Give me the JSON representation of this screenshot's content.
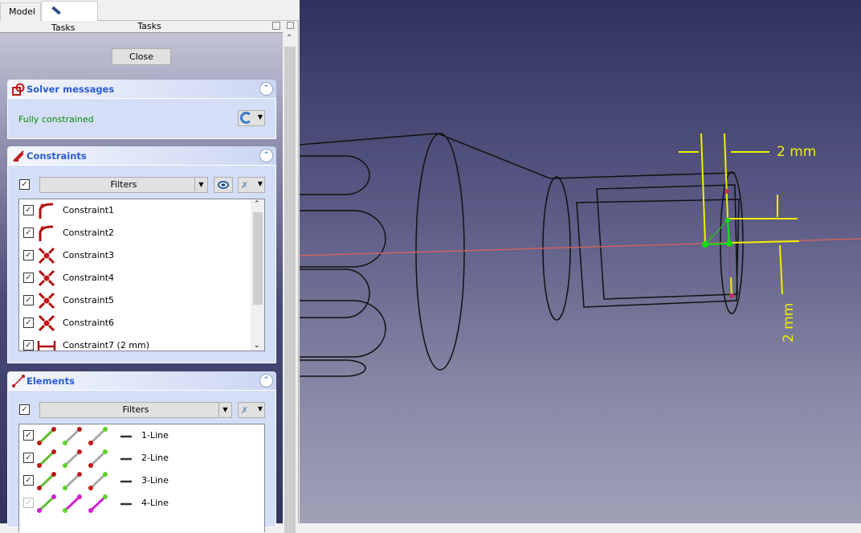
{
  "tabs": [
    {
      "label": "Model",
      "active": false
    },
    {
      "label": "Tasks",
      "active": true
    }
  ],
  "tasks_header": "Tasks",
  "close_button": "Close",
  "solver": {
    "title": "Solver messages",
    "status": "Fully constrained",
    "status_color": "#0a8a0a"
  },
  "constraints": {
    "title": "Constraints",
    "filter_label": "Filters",
    "items": [
      {
        "label": "Constraint1",
        "icon": "tangent-icon",
        "checked": true
      },
      {
        "label": "Constraint2",
        "icon": "tangent-icon",
        "checked": true
      },
      {
        "label": "Constraint3",
        "icon": "coincident-icon",
        "checked": true
      },
      {
        "label": "Constraint4",
        "icon": "coincident-icon",
        "checked": true
      },
      {
        "label": "Constraint5",
        "icon": "coincident-icon",
        "checked": true
      },
      {
        "label": "Constraint6",
        "icon": "coincident-icon",
        "checked": true
      },
      {
        "label": "Constraint7 (2 mm)",
        "icon": "horizontal-distance-icon",
        "checked": true
      }
    ]
  },
  "elements": {
    "title": "Elements",
    "filter_label": "Filters",
    "items": [
      {
        "label": "1-Line",
        "checked": true
      },
      {
        "label": "2-Line",
        "checked": true
      },
      {
        "label": "3-Line",
        "checked": true
      },
      {
        "label": "4-Line",
        "checked": false
      }
    ]
  },
  "viewport": {
    "dim_horizontal": "2 mm",
    "dim_vertical": "2 mm"
  },
  "colors": {
    "accent": "#2a5ad6",
    "constraint_red": "#b01010",
    "dimension_yellow": "#f0f000"
  }
}
